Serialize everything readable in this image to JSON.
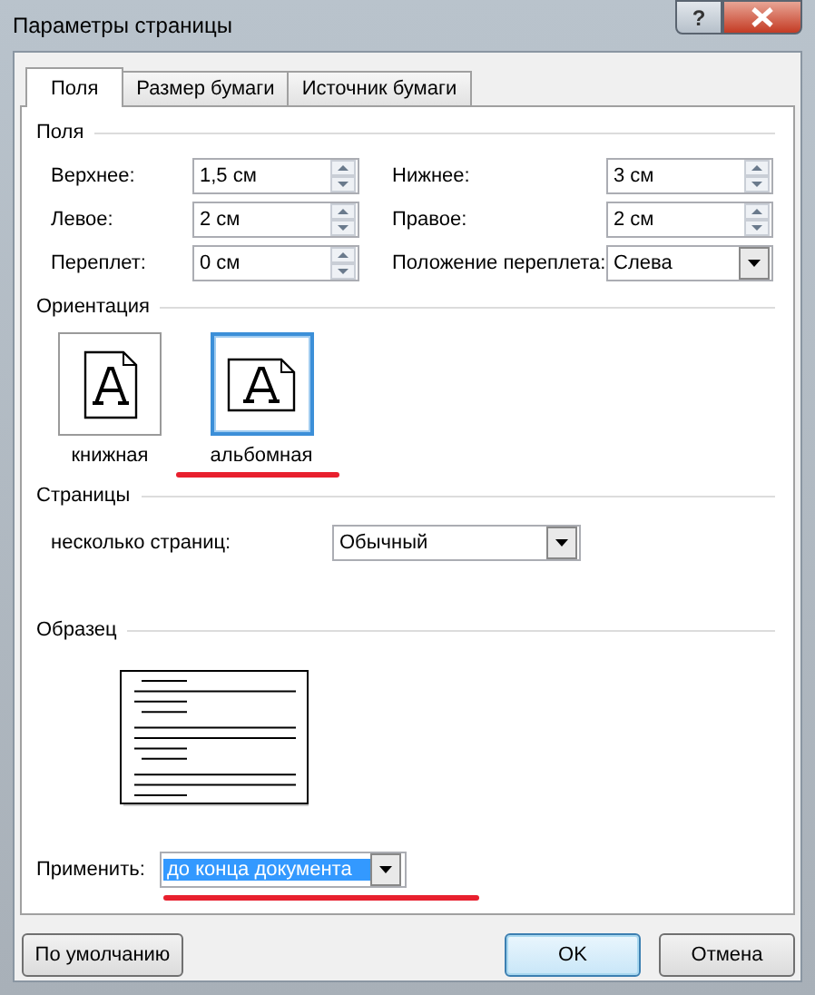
{
  "window": {
    "title": "Параметры страницы",
    "help": "?"
  },
  "tabs": [
    {
      "label": "Поля",
      "selected": true
    },
    {
      "label": "Размер бумаги",
      "selected": false
    },
    {
      "label": "Источник бумаги",
      "selected": false
    }
  ],
  "margins": {
    "title": "Поля",
    "fields": [
      {
        "label": "Верхнее:",
        "value": "1,5 см",
        "kind": "spin"
      },
      {
        "label": "Нижнее:",
        "value": "3 см",
        "kind": "spin"
      },
      {
        "label": "Левое:",
        "value": "2 см",
        "kind": "spin"
      },
      {
        "label": "Правое:",
        "value": "2 см",
        "kind": "spin"
      },
      {
        "label": "Переплет:",
        "value": "0 см",
        "kind": "spin"
      },
      {
        "label": "Положение переплета:",
        "value": "Слева",
        "kind": "dropdown"
      }
    ]
  },
  "orientation": {
    "title": "Ориентация",
    "options": [
      {
        "label": "книжная",
        "kind": "portrait",
        "selected": false
      },
      {
        "label": "альбомная",
        "kind": "landscape",
        "selected": true
      }
    ]
  },
  "pages": {
    "title": "Страницы",
    "label": "несколько страниц:",
    "value": "Обычный"
  },
  "preview": {
    "title": "Образец"
  },
  "apply": {
    "label": "Применить:",
    "value": "до конца документа"
  },
  "buttons": [
    {
      "label": "По умолчанию",
      "default": false
    },
    {
      "label": "OK",
      "default": true
    },
    {
      "label": "Отмена",
      "default": false
    }
  ]
}
